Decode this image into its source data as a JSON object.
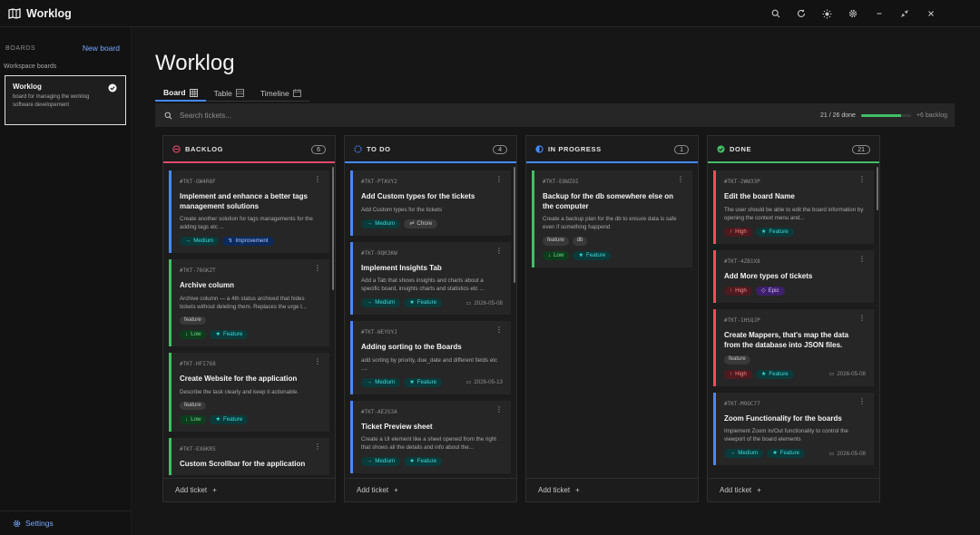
{
  "app": {
    "title": "Worklog"
  },
  "sidebar": {
    "boards_label": "BOARDS",
    "new_board": "New board",
    "workspace_label": "Workspace boards",
    "board": {
      "name": "Worklog",
      "description": "board for managing the worklog software developement"
    },
    "settings": "Settings"
  },
  "page": {
    "title": "Worklog"
  },
  "tabs": [
    {
      "label": "Board"
    },
    {
      "label": "Table"
    },
    {
      "label": "Timeline"
    }
  ],
  "search": {
    "placeholder": "Search tickets..."
  },
  "progress": {
    "text": "21 / 26 done",
    "done": 21,
    "total": 26,
    "backlog_more": "+6 backlog"
  },
  "colors": {
    "backlog": "#e5496b",
    "todo": "#4589ff",
    "in_progress": "#4589ff",
    "done": "#42be65",
    "high": "#fa4d56",
    "medium": "#3ddbd9",
    "low": "#42be65",
    "feature": "#3ddbd9",
    "improvement": "#78a9ff",
    "epic": "#be95ff",
    "chore": "#a8a8a8"
  },
  "columns": [
    {
      "title": "BACKLOG",
      "count": "6",
      "add": "Add ticket",
      "tickets": [
        {
          "id": "#TKT-GW4R8F",
          "title": "Implement and enhance a better tags management solutions",
          "desc": "Create another solution for tags managements for the adding tags etc ...",
          "tags": [],
          "priority": "Medium",
          "type": "Improvement",
          "date": ""
        },
        {
          "id": "#TKT-76GKZT",
          "title": "Archive column",
          "desc": "Archive column — a 4th status archived that hides tickets without deleting them. Replaces the urge t...",
          "tags": [
            "feature"
          ],
          "priority": "Low",
          "type": "Feature",
          "date": ""
        },
        {
          "id": "#TKT-HFI768",
          "title": "Create Website for the application",
          "desc": "Describe the task clearly and keep it actionable.",
          "tags": [
            "feature"
          ],
          "priority": "Low",
          "type": "Feature",
          "date": ""
        },
        {
          "id": "#TKT-EX6KR5",
          "title": "Custom Scrollbar for the application",
          "desc": "",
          "tags": [],
          "priority": "",
          "type": "",
          "date": ""
        }
      ]
    },
    {
      "title": "TO DO",
      "count": "4",
      "add": "Add ticket",
      "tickets": [
        {
          "id": "#TKT-PTAVY2",
          "title": "Add Custom types for the tickets",
          "desc": "Add Custom types for the tickets",
          "tags": [],
          "priority": "Medium",
          "type": "Chore",
          "date": ""
        },
        {
          "id": "#TKT-9QK3KW",
          "title": "Implement Insights Tab",
          "desc": "Add a Tab that shows insights and charts about a specific board, insights charts and statistics etc ...",
          "tags": [],
          "priority": "Medium",
          "type": "Feature",
          "date": "2026-05-08"
        },
        {
          "id": "#TKT-WEYUYJ",
          "title": "Adding sorting to the Boards",
          "desc": "add sorting by priority, due_date and different fields etc ....",
          "tags": [],
          "priority": "Medium",
          "type": "Feature",
          "date": "2026-05-13"
        },
        {
          "id": "#TKT-AE2S3A",
          "title": "Ticket Preview sheet",
          "desc": "Create a UI element like a sheet opened from the right that shows all the details and info about the...",
          "tags": [],
          "priority": "Medium",
          "type": "Feature",
          "date": ""
        }
      ]
    },
    {
      "title": "IN PROGRESS",
      "count": "1",
      "add": "Add ticket",
      "tickets": [
        {
          "id": "#TKT-E8WZOI",
          "title": "Backup for the db somewhere else on the computer",
          "desc": "Create a backup plan for the db to ensure data is safe even if something happend",
          "tags": [
            "feature",
            "db"
          ],
          "priority": "Low",
          "type": "Feature",
          "date": ""
        }
      ]
    },
    {
      "title": "DONE",
      "count": "21",
      "add": "Add ticket",
      "tickets": [
        {
          "id": "#TKT-2WW33P",
          "title": "Edit the board Name",
          "desc": "The user should be able to edit the board information by opening the context menu and...",
          "tags": [],
          "priority": "High",
          "type": "Feature",
          "date": ""
        },
        {
          "id": "#TKT-4ZB1X8",
          "title": "Add More types of tickets",
          "desc": "",
          "tags": [],
          "priority": "High",
          "type": "Epic",
          "date": ""
        },
        {
          "id": "#TKT-1HSQJP",
          "title": "Create Mappers, that's map the data from the database into JSON files.",
          "desc": "",
          "tags": [
            "feature"
          ],
          "priority": "High",
          "type": "Feature",
          "date": "2026-05-08"
        },
        {
          "id": "#TKT-M9OC77",
          "title": "Zoom Functionality for the boards",
          "desc": "Implement Zoom In/Out functionality to control the viewport of the board elements",
          "tags": [],
          "priority": "Medium",
          "type": "Feature",
          "date": "2026-05-08"
        }
      ]
    }
  ]
}
